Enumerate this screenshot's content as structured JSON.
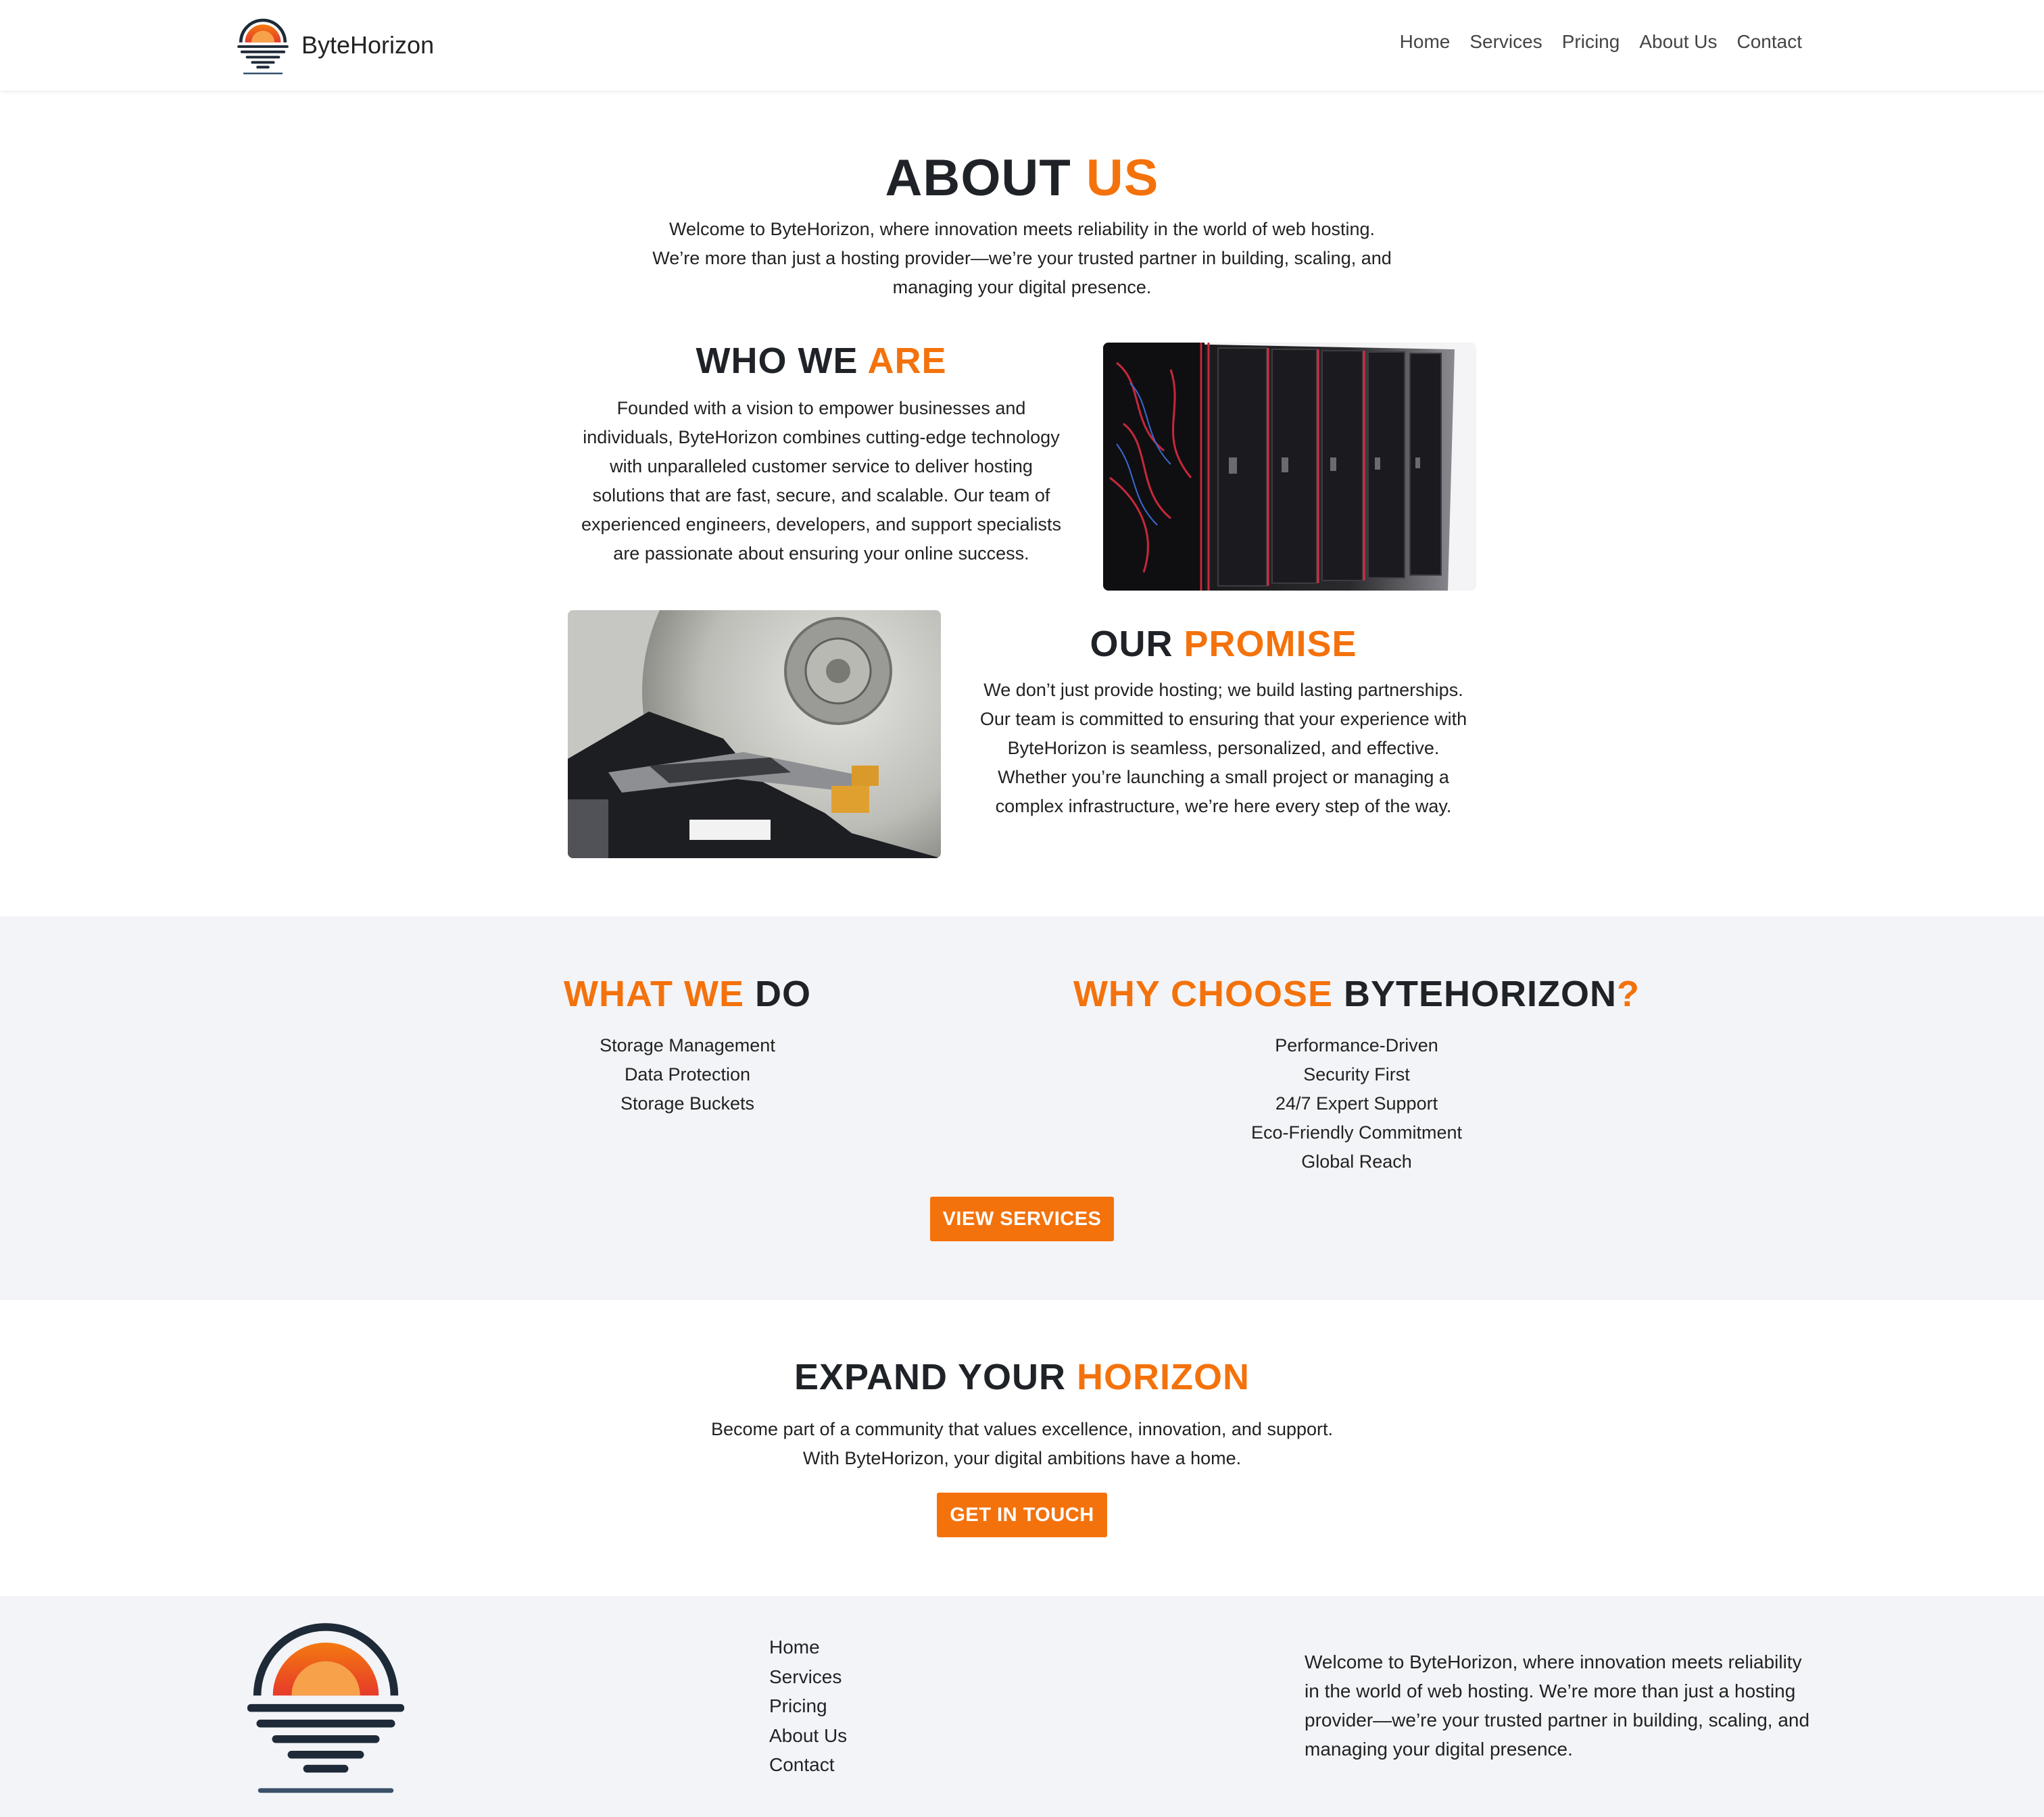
{
  "header": {
    "brand": "ByteHorizon",
    "nav": [
      "Home",
      "Services",
      "Pricing",
      "About Us",
      "Contact"
    ]
  },
  "about": {
    "title_a": "ABOUT ",
    "title_b": "US",
    "intro_lines": [
      "Welcome to ByteHorizon, where innovation meets reliability in the world of web hosting.",
      "We’re more than just a hosting provider—we’re your trusted partner in building, scaling, and",
      "managing your digital presence."
    ]
  },
  "who": {
    "title_a": "WHO WE ",
    "title_b": "ARE",
    "lines": [
      "Founded with a vision to empower businesses and",
      "individuals, ByteHorizon combines cutting-edge technology",
      "with unparalleled customer service to deliver hosting",
      "solutions that are fast, secure, and scalable. Our team of",
      "experienced engineers, developers, and support specialists",
      "are passionate about ensuring your online success."
    ]
  },
  "promise": {
    "title_a": "OUR ",
    "title_b": "PROMISE",
    "lines": [
      "We don’t just provide hosting; we build lasting partnerships.",
      "Our team is committed to ensuring that your experience with",
      "ByteHorizon is seamless, personalized, and effective.",
      "Whether you’re launching a small project or managing a",
      "complex infrastructure, we’re here every step of the way."
    ]
  },
  "what_we_do": {
    "title_a": "WHAT WE ",
    "title_b": "DO",
    "items": [
      "Storage Management",
      "Data Protection",
      "Storage Buckets"
    ]
  },
  "why": {
    "title_a": "WHY CHOOSE ",
    "title_b": "BYTEHORIZON",
    "title_c": "?",
    "items": [
      "Performance-Driven",
      "Security First",
      "24/7 Expert Support",
      "Eco-Friendly Commitment",
      "Global Reach"
    ]
  },
  "buttons": {
    "view_services": "VIEW SERVICES",
    "get_in_touch": "GET IN TOUCH"
  },
  "expand": {
    "title_a": "EXPAND YOUR ",
    "title_b": "HORIZON",
    "lines": [
      "Become part of a community that values excellence, innovation, and support.",
      "With ByteHorizon, your digital ambitions have a home."
    ]
  },
  "footer": {
    "nav": [
      "Home",
      "Services",
      "Pricing",
      "About Us",
      "Contact"
    ],
    "lines": [
      "Welcome to ByteHorizon, where innovation meets reliability",
      "in the world of web hosting. We’re more than just a hosting",
      "provider—we’re your trusted partner in building, scaling, and",
      "managing your digital presence."
    ]
  },
  "colors": {
    "accent": "#f4720c",
    "dark": "#1f2328",
    "section_bg": "#f3f4f7"
  }
}
